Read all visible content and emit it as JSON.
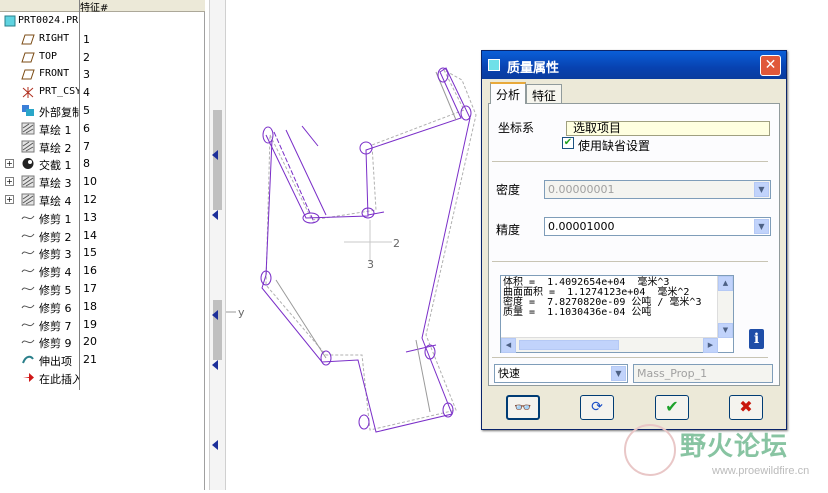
{
  "tree": {
    "header_col2": "特征#",
    "rows": [
      {
        "label": "PRT0024.PR",
        "num": ""
      },
      {
        "label": "RIGHT",
        "num": "1"
      },
      {
        "label": "TOP",
        "num": "2"
      },
      {
        "label": "FRONT",
        "num": "3"
      },
      {
        "label": "PRT_CSYS",
        "num": "4"
      },
      {
        "label": "外部复制",
        "num": "5"
      },
      {
        "label": "草绘 1",
        "num": "6"
      },
      {
        "label": "草绘 2",
        "num": "7"
      },
      {
        "label": "交截 1",
        "num": "8"
      },
      {
        "label": "草绘 3",
        "num": "10"
      },
      {
        "label": "草绘 4",
        "num": "12"
      },
      {
        "label": "修剪 1",
        "num": "13"
      },
      {
        "label": "修剪 2",
        "num": "14"
      },
      {
        "label": "修剪 3",
        "num": "15"
      },
      {
        "label": "修剪 4",
        "num": "16"
      },
      {
        "label": "修剪 5",
        "num": "17"
      },
      {
        "label": "修剪 6",
        "num": "18"
      },
      {
        "label": "修剪 7",
        "num": "19"
      },
      {
        "label": "修剪 9",
        "num": "20"
      },
      {
        "label": "伸出项",
        "num": "21"
      },
      {
        "label": "在此插入",
        "num": ""
      }
    ]
  },
  "graphics": {
    "csys_label": "2",
    "csys_label2": "3",
    "axis_label": "y"
  },
  "dialog": {
    "title": "质量属性",
    "close": "✕",
    "tabs": [
      "分析",
      "特征"
    ],
    "csys_label": "坐标系",
    "csys_value": "选取项目",
    "default_check": "使用缺省设置",
    "density_label": "密度",
    "density_value": "0.00000001",
    "accuracy_label": "精度",
    "accuracy_value": "0.00001000",
    "results": "体积 =  1.4092654e+04  毫米^3\n曲面面积 =  1.1274123e+04  毫米^2\n密度 =  7.8270820e-09 公吨 / 毫米^3\n质量 =  1.1030436e-04 公吨",
    "mode_value": "快速",
    "name_placeholder": "Mass_Prop_1",
    "info": "i",
    "buttons": [
      "preview-glasses",
      "repeat",
      "ok",
      "cancel"
    ]
  },
  "watermark": {
    "text": "野火论坛",
    "url": "www.proewildfire.cn"
  },
  "colors": {
    "title_bar": "#0a4fc4",
    "sketch_purple": "#7a2ec8",
    "ok_green": "#1da12b",
    "cancel_red": "#c9160b"
  }
}
